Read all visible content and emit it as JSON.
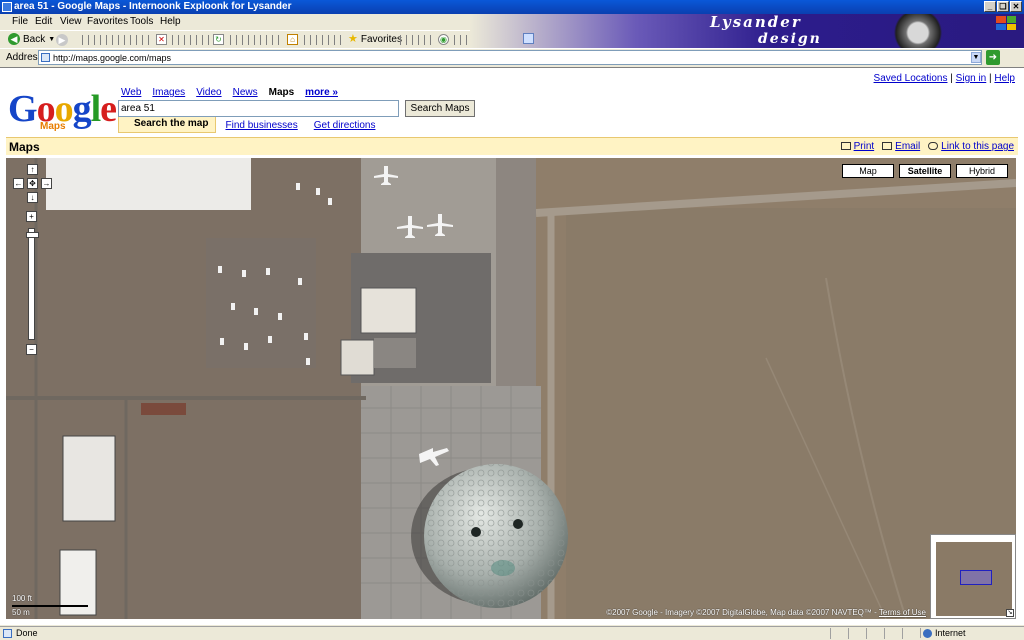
{
  "window": {
    "title": "area 51 - Google Maps - Internoonk Exploonk for Lysander",
    "controls": [
      "_",
      "❑",
      "✕"
    ]
  },
  "menu": {
    "items": [
      "File",
      "Edit",
      "View",
      "Favorites",
      "Tools",
      "Help"
    ]
  },
  "brand": {
    "line1": "Lysander",
    "line2": "design"
  },
  "toolbar": {
    "back_label": "Back",
    "favorites_label": "Favorites"
  },
  "address": {
    "label": "Address",
    "url": "http://maps.google.com/maps"
  },
  "google": {
    "top_links": [
      "Saved Locations",
      "Sign in",
      "Help"
    ],
    "logo_letters": [
      "G",
      "o",
      "o",
      "g",
      "l",
      "e"
    ],
    "logo_sub": "Maps",
    "nav_links": [
      "Web",
      "Images",
      "Video",
      "News"
    ],
    "nav_current": "Maps",
    "nav_more": "more »",
    "search_value": "area 51",
    "search_button": "Search Maps",
    "subtabs": [
      "Search the map",
      "Find businesses",
      "Get directions"
    ],
    "maps_title": "Maps",
    "maps_links": [
      "Print",
      "Email",
      "Link to this page"
    ]
  },
  "map": {
    "types": [
      "Map",
      "Satellite",
      "Hybrid"
    ],
    "selected_type": "Satellite",
    "pan_arrows": [
      "↑",
      "←",
      "→",
      "↓"
    ],
    "zoom_in": "+",
    "zoom_out": "−",
    "scale_ft": "100 ft",
    "scale_m": "50 m",
    "copyright": "©2007 Google - Imagery ©2007 DigitalGlobe, Map data ©2007 NAVTEQ™ -",
    "terms": "Terms of Use",
    "overview_toggle": "↘"
  },
  "status": {
    "text": "Done",
    "zone": "Internet"
  },
  "colors": {
    "desert": "#8e7d6c",
    "ground": "#7d7064",
    "runway": "#9a958f",
    "accent_link": "#0000cc",
    "maps_bar": "#fff3c4"
  }
}
